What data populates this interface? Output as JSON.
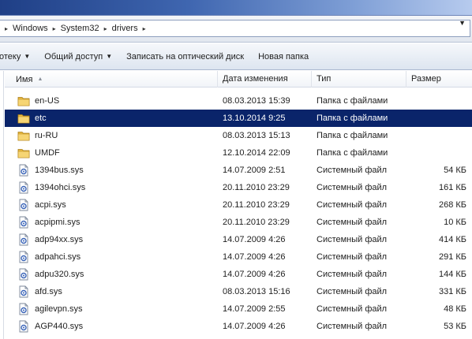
{
  "address": {
    "crumbs": [
      "Windows",
      "System32",
      "drivers"
    ],
    "separator": "▸",
    "dropdown_glyph": "▼"
  },
  "toolbar": {
    "items": [
      {
        "label": "отеку",
        "has_dropdown": true
      },
      {
        "label": "Общий доступ",
        "has_dropdown": true
      },
      {
        "label": "Записать на оптический диск",
        "has_dropdown": false
      },
      {
        "label": "Новая папка",
        "has_dropdown": false
      }
    ],
    "dropdown_glyph": "▼"
  },
  "columns": {
    "name": "Имя",
    "date": "Дата изменения",
    "type": "Тип",
    "size": "Размер",
    "sort_glyph": "▲"
  },
  "files": [
    {
      "name": "en-US",
      "date": "08.03.2013 15:39",
      "type": "Папка с файлами",
      "size": "",
      "kind": "folder",
      "selected": false
    },
    {
      "name": "etc",
      "date": "13.10.2014 9:25",
      "type": "Папка с файлами",
      "size": "",
      "kind": "folder",
      "selected": true
    },
    {
      "name": "ru-RU",
      "date": "08.03.2013 15:13",
      "type": "Папка с файлами",
      "size": "",
      "kind": "folder",
      "selected": false
    },
    {
      "name": "UMDF",
      "date": "12.10.2014 22:09",
      "type": "Папка с файлами",
      "size": "",
      "kind": "folder",
      "selected": false
    },
    {
      "name": "1394bus.sys",
      "date": "14.07.2009 2:51",
      "type": "Системный файл",
      "size": "54 КБ",
      "kind": "sys",
      "selected": false
    },
    {
      "name": "1394ohci.sys",
      "date": "20.11.2010 23:29",
      "type": "Системный файл",
      "size": "161 КБ",
      "kind": "sys",
      "selected": false
    },
    {
      "name": "acpi.sys",
      "date": "20.11.2010 23:29",
      "type": "Системный файл",
      "size": "268 КБ",
      "kind": "sys",
      "selected": false
    },
    {
      "name": "acpipmi.sys",
      "date": "20.11.2010 23:29",
      "type": "Системный файл",
      "size": "10 КБ",
      "kind": "sys",
      "selected": false
    },
    {
      "name": "adp94xx.sys",
      "date": "14.07.2009 4:26",
      "type": "Системный файл",
      "size": "414 КБ",
      "kind": "sys",
      "selected": false
    },
    {
      "name": "adpahci.sys",
      "date": "14.07.2009 4:26",
      "type": "Системный файл",
      "size": "291 КБ",
      "kind": "sys",
      "selected": false
    },
    {
      "name": "adpu320.sys",
      "date": "14.07.2009 4:26",
      "type": "Системный файл",
      "size": "144 КБ",
      "kind": "sys",
      "selected": false
    },
    {
      "name": "afd.sys",
      "date": "08.03.2013 15:16",
      "type": "Системный файл",
      "size": "331 КБ",
      "kind": "sys",
      "selected": false
    },
    {
      "name": "agilevpn.sys",
      "date": "14.07.2009 2:55",
      "type": "Системный файл",
      "size": "48 КБ",
      "kind": "sys",
      "selected": false
    },
    {
      "name": "AGP440.sys",
      "date": "14.07.2009 4:26",
      "type": "Системный файл",
      "size": "53 КБ",
      "kind": "sys",
      "selected": false
    }
  ],
  "colors": {
    "selection": "#0a246a",
    "folder": "#e8b941",
    "sys_icon": "#3a64b8"
  },
  "icons": {
    "folder": "folder-icon",
    "sys": "system-file-icon"
  }
}
